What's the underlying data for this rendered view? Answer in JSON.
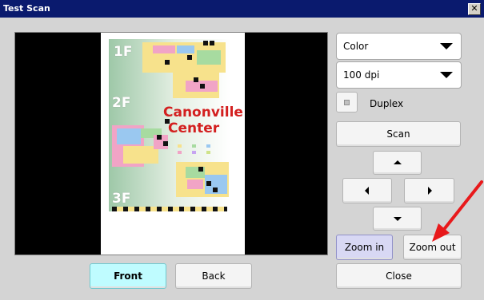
{
  "window": {
    "title": "Test Scan",
    "close_glyph": "✕"
  },
  "preview": {
    "floors": [
      "1F",
      "2F",
      "3F"
    ],
    "brand_line1": "Canonville",
    "brand_line2": "Center"
  },
  "controls": {
    "color_mode": {
      "selected": "Color"
    },
    "resolution": {
      "selected": "100 dpi"
    },
    "duplex_label": "Duplex",
    "scan_label": "Scan",
    "zoom_in_label": "Zoom in",
    "zoom_out_label": "Zoom out",
    "close_label": "Close",
    "front_label": "Front",
    "back_label": "Back"
  },
  "colors": {
    "titlebar": "#0a1a6e",
    "front_active": "#bffcff",
    "zoom_in_active": "#d8d8f4",
    "annotation_arrow": "#e8191b",
    "brand_red": "#d31f1f"
  }
}
